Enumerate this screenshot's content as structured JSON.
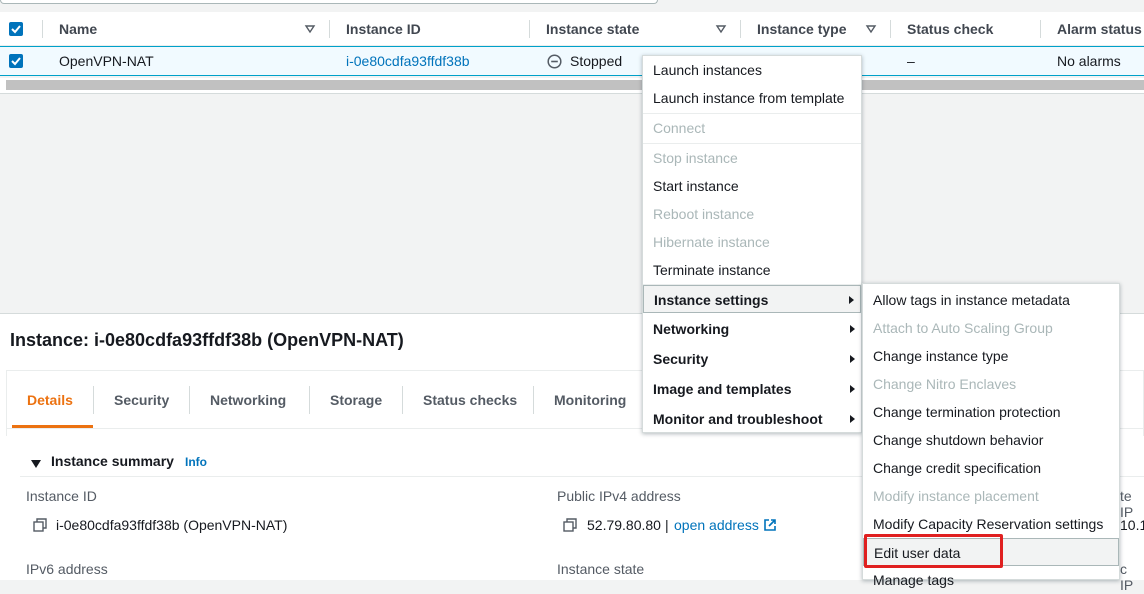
{
  "table": {
    "columns": [
      {
        "label": "Name"
      },
      {
        "label": "Instance ID"
      },
      {
        "label": "Instance state"
      },
      {
        "label": "Instance type"
      },
      {
        "label": "Status check"
      },
      {
        "label": "Alarm status"
      }
    ],
    "row": {
      "name": "OpenVPN-NAT",
      "instance_id": "i-0e80cdfa93ffdf38b",
      "state": "Stopped",
      "status_check": "–",
      "alarm_status": "No alarms"
    }
  },
  "panel": {
    "title": "Instance: i-0e80cdfa93ffdf38b (OpenVPN-NAT)",
    "tabs": [
      "Details",
      "Security",
      "Networking",
      "Storage",
      "Status checks",
      "Monitoring"
    ],
    "summary_title": "Instance summary",
    "info_link": "Info",
    "fields": {
      "instance_id_label": "Instance ID",
      "instance_id_value": "i-0e80cdfa93ffdf38b (OpenVPN-NAT)",
      "public_ipv4_label": "Public IPv4 address",
      "public_ipv4_value": "52.79.80.80",
      "public_ipv4_sep": "|",
      "open_address": "open address",
      "ipv6_label": "IPv6 address",
      "instance_state_label": "Instance state"
    },
    "cutoff": {
      "right_label_1": "te IP",
      "right_value_1": "10.1",
      "right_label_2": "c IP"
    }
  },
  "context_menu": {
    "items": [
      {
        "label": "Launch instances",
        "disabled": false
      },
      {
        "label": "Launch instance from template",
        "disabled": false
      },
      {
        "label": "Connect",
        "disabled": true
      },
      {
        "label": "Stop instance",
        "disabled": true
      },
      {
        "label": "Start instance",
        "disabled": false
      },
      {
        "label": "Reboot instance",
        "disabled": true
      },
      {
        "label": "Hibernate instance",
        "disabled": true
      },
      {
        "label": "Terminate instance",
        "disabled": false
      },
      {
        "label": "Instance settings",
        "disabled": false
      },
      {
        "label": "Networking",
        "disabled": false
      },
      {
        "label": "Security",
        "disabled": false
      },
      {
        "label": "Image and templates",
        "disabled": false
      },
      {
        "label": "Monitor and troubleshoot",
        "disabled": false
      }
    ]
  },
  "submenu": {
    "items": [
      {
        "label": "Allow tags in instance metadata",
        "disabled": false
      },
      {
        "label": "Attach to Auto Scaling Group",
        "disabled": true
      },
      {
        "label": "Change instance type",
        "disabled": false
      },
      {
        "label": "Change Nitro Enclaves",
        "disabled": true
      },
      {
        "label": "Change termination protection",
        "disabled": false
      },
      {
        "label": "Change shutdown behavior",
        "disabled": false
      },
      {
        "label": "Change credit specification",
        "disabled": false
      },
      {
        "label": "Modify instance placement",
        "disabled": true
      },
      {
        "label": "Modify Capacity Reservation settings",
        "disabled": false
      },
      {
        "label": "Edit user data",
        "disabled": false
      },
      {
        "label": "Manage tags",
        "disabled": false
      }
    ]
  },
  "colors": {
    "accent_orange": "#ec7211",
    "link_blue": "#0073bb",
    "highlight_red": "#e02020",
    "disabled_gray": "#aab7b8"
  }
}
